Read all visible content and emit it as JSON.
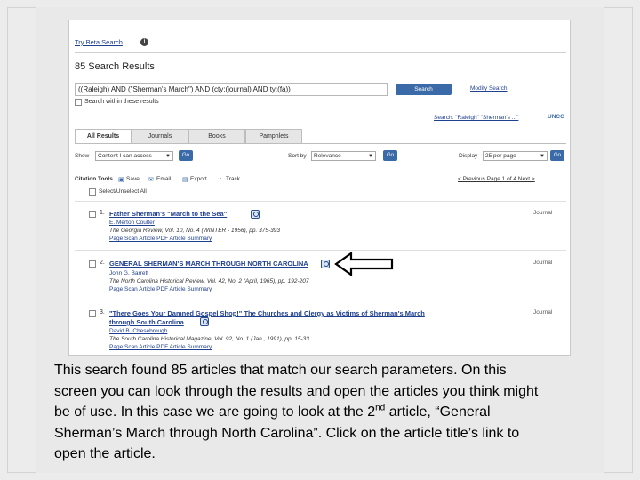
{
  "header": {
    "beta_link": "Try Beta Search",
    "info_icon": "i",
    "results_title": "85 Search Results"
  },
  "search": {
    "query": "((Raleigh) AND (\"Sherman's March\") AND (cty:(journal) AND ty:(fa))",
    "button": "Search",
    "modify": "Modify Search",
    "within": "Search within these results",
    "saved_link": "Search: \"Raleigh\" \"Sherman's ...\"",
    "logo": "UNCG"
  },
  "tabs": [
    {
      "label": "All Results"
    },
    {
      "label": "Journals"
    },
    {
      "label": "Books"
    },
    {
      "label": "Pamphlets"
    }
  ],
  "filters": {
    "show_label": "Show",
    "show_value": "Content I can access",
    "sort_label": "Sort by",
    "sort_value": "Relevance",
    "display_label": "Display",
    "display_value": "25 per page",
    "go": "Go"
  },
  "tools": {
    "label": "Citation Tools",
    "save": "Save",
    "email": "Email",
    "export": "Export",
    "track": "Track",
    "pagination": "< Previous  Page 1 of 4  Next >",
    "select_all": "Select/Unselect All"
  },
  "results": [
    {
      "num": "1.",
      "title": "Father Sherman's \"March to the Sea\"",
      "type": "Journal",
      "author": "E. Merton Coulter",
      "pub": "The Georgia Review, Vol. 10, No. 4 (WINTER - 1956), pp. 375-393",
      "links": "Page Scan   Article PDF   Article Summary"
    },
    {
      "num": "2.",
      "title": "GENERAL SHERMAN'S MARCH THROUGH NORTH CAROLINA",
      "type": "Journal",
      "author": "John G. Barrett",
      "pub": "The North Carolina Historical Review, Vol. 42, No. 2 (April, 1965), pp. 192-207",
      "links": "Page Scan   Article PDF   Article Summary"
    },
    {
      "num": "3.",
      "title": "\"There Goes Your Damned Gospel Shop!\" The Churches and Clergy as Victims of Sherman's March",
      "title2": "through South Carolina",
      "type": "Journal",
      "author": "David B. Chesebrough",
      "pub": "The South Carolina Historical Magazine, Vol. 92, No. 1 (Jan., 1991), pp. 15-33",
      "links": "Page Scan   Article PDF   Article Summary"
    }
  ],
  "caption": {
    "line1": "This search found 85 articles that match our search parameters. On this",
    "line2": "screen you can look through the results and open the articles you think might",
    "line3_pre": "be of use. In this case we are going to look at the 2",
    "line3_sup": "nd",
    "line3_post": " article, “General",
    "line4": "Sherman’s March through North Carolina”.  Click on the article title’s link to",
    "line5": "open the article."
  },
  "colors": {
    "link": "#1f3f8f",
    "button": "#3a6aa7"
  }
}
